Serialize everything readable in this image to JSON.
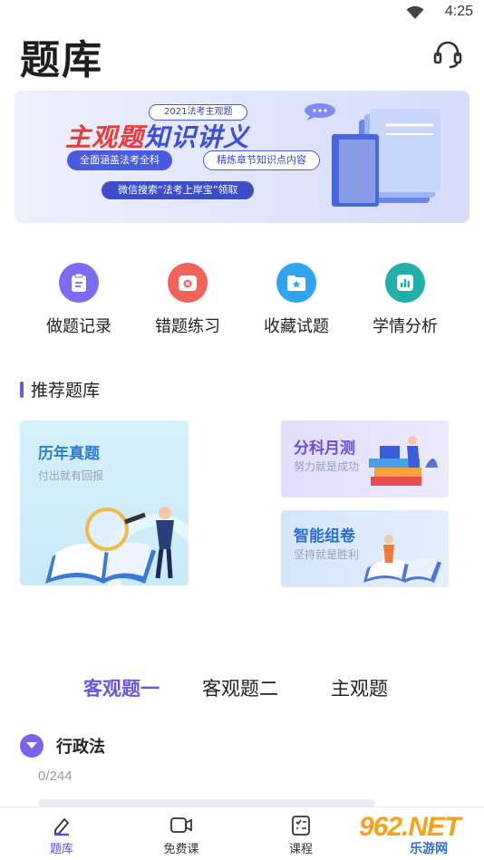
{
  "status_bar": {
    "time": "4:25"
  },
  "header": {
    "title": "题库"
  },
  "banner": {
    "chip_top": "2021法考主观题",
    "headline_red": "主观题",
    "headline_blue": "知识讲义",
    "pill_left": "全面涵盖法考全科",
    "pill_right": "精炼章节知识点内容",
    "pill_bottom": "微信搜索“法考上岸宝”领取"
  },
  "quick_actions": [
    {
      "label": "做题记录",
      "color": "#7b6cf0"
    },
    {
      "label": "错题练习",
      "color": "#f2645a"
    },
    {
      "label": "收藏试题",
      "color": "#2ea4f2"
    },
    {
      "label": "学情分析",
      "color": "#21b0a8"
    }
  ],
  "recommend": {
    "title": "推荐题库",
    "cards": [
      {
        "title": "历年真题",
        "subtitle": "付出就有回报"
      },
      {
        "title": "分科月测",
        "subtitle": "努力就是成功"
      },
      {
        "title": "智能组卷",
        "subtitle": "坚持就是胜利"
      }
    ]
  },
  "tabs": [
    {
      "label": "客观题一",
      "active": true
    },
    {
      "label": "客观题二",
      "active": false
    },
    {
      "label": "主观题",
      "active": false
    }
  ],
  "subject": {
    "name": "行政法",
    "progress": "0/244",
    "progress_fraction": 0
  },
  "bottom_nav": [
    {
      "label": "题库",
      "icon": "edit-icon",
      "active": true
    },
    {
      "label": "免费课",
      "icon": "video-icon",
      "active": false
    },
    {
      "label": "课程",
      "icon": "checklist-icon",
      "active": false
    }
  ],
  "watermark": {
    "main": "962.NET",
    "sub": "乐游网"
  },
  "colors": {
    "accent": "#6a55e2",
    "active_nav": "#5a4be0"
  }
}
